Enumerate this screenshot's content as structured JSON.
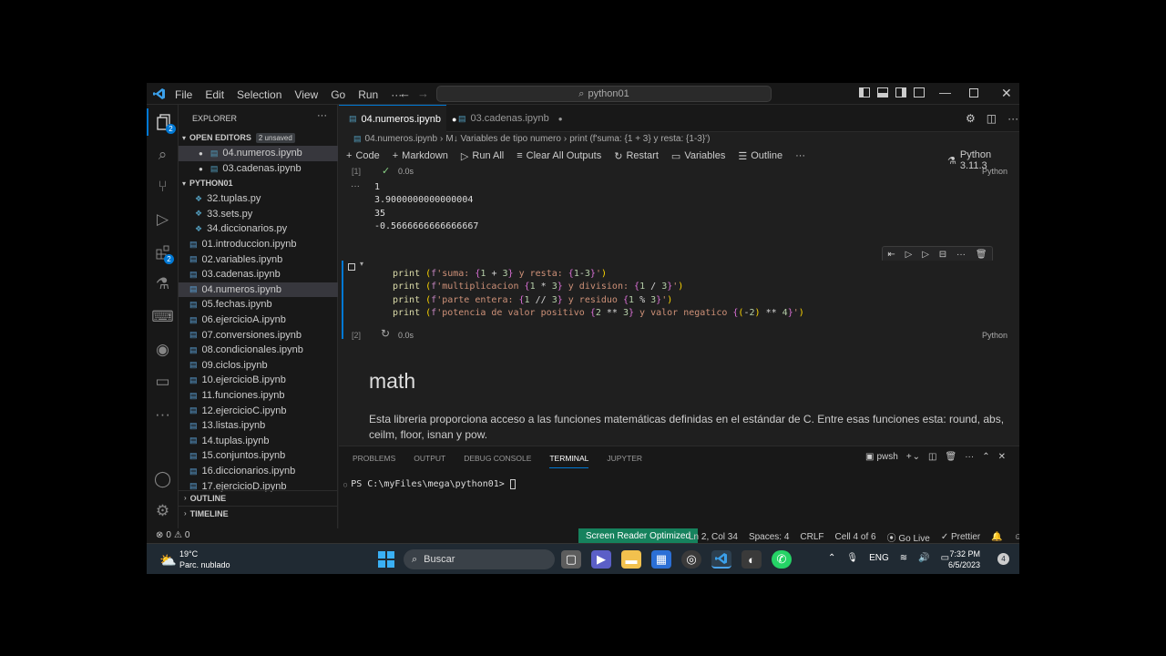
{
  "menu": [
    "File",
    "Edit",
    "Selection",
    "View",
    "Go",
    "Run"
  ],
  "menu_more": "···",
  "search": {
    "text": "python01"
  },
  "explorer": {
    "title": "EXPLORER",
    "more": "···",
    "open_editors": "OPEN EDITORS",
    "unsaved_badge": "2 unsaved",
    "open_files": [
      "04.numeros.ipynb",
      "03.cadenas.ipynb"
    ],
    "folder": "PYTHON01",
    "files": [
      "32.tuplas.py",
      "33.sets.py",
      "34.diccionarios.py",
      "01.introduccion.ipynb",
      "02.variables.ipynb",
      "03.cadenas.ipynb",
      "04.numeros.ipynb",
      "05.fechas.ipynb",
      "06.ejercicioA.ipynb",
      "07.conversiones.ipynb",
      "08.condicionales.ipynb",
      "09.ciclos.ipynb",
      "10.ejercicioB.ipynb",
      "11.funciones.ipynb",
      "12.ejercicioC.ipynb",
      "13.listas.ipynb",
      "14.tuplas.ipynb",
      "15.conjuntos.ipynb",
      "16.diccionarios.ipynb",
      "17.ejercicioD.ipynb"
    ],
    "outline": "OUTLINE",
    "timeline": "TIMELINE"
  },
  "activity_badges": {
    "explorer": "2",
    "extensions": "2"
  },
  "tabs": [
    {
      "label": "04.numeros.ipynb"
    },
    {
      "label": "03.cadenas.ipynb"
    }
  ],
  "breadcrumb": {
    "file": "04.numeros.ipynb",
    "section": "M↓ Variables de tipo numero",
    "cell": "print (f'suma: {1 + 3} y resta: {1-3}')"
  },
  "toolbar": {
    "code": "Code",
    "markdown": "Markdown",
    "run_all": "Run All",
    "clear": "Clear All Outputs",
    "restart": "Restart",
    "variables": "Variables",
    "outline": "Outline",
    "more": "···",
    "kernel": "Python 3.11.3"
  },
  "cell1": {
    "index": "[1]",
    "time": "0.0s",
    "lang": "Python",
    "outputs": [
      "1",
      "3.9000000000000004",
      "35",
      "-0.5666666666666667"
    ],
    "more": "···"
  },
  "cell2": {
    "index": "[2]",
    "time": "0.0s",
    "lang": "Python"
  },
  "markdown": {
    "heading": "math",
    "text": "Esta libreria proporciona acceso a las funciones matemáticas definidas en el estándar de C. Entre esas funciones esta: round, abs, ceilm, floor, isnan y pow."
  },
  "panel": {
    "tabs": [
      "PROBLEMS",
      "OUTPUT",
      "DEBUG CONSOLE",
      "TERMINAL",
      "JUPYTER"
    ],
    "active": "TERMINAL",
    "shell": "pwsh",
    "prompt": "PS C:\\myFiles\\mega\\python01> "
  },
  "status": {
    "errors": "0",
    "warnings": "0",
    "reader": "Screen Reader Optimized",
    "position": "Ln 2, Col 34",
    "spaces": "Spaces: 4",
    "eol": "CRLF",
    "cell": "Cell 4 of 6",
    "golive": "Go Live",
    "prettier": "Prettier"
  },
  "taskbar": {
    "temp": "19°C",
    "weather": "Parc. nublado",
    "search": "Buscar",
    "lang": "ENG",
    "time": "7:32 PM",
    "date": "6/5/2023",
    "notif": "4"
  },
  "colors": {
    "accent": "#0078d4",
    "background": "#1f1f1f",
    "statusbar": "#181818",
    "screen_reader": "#16825d"
  }
}
